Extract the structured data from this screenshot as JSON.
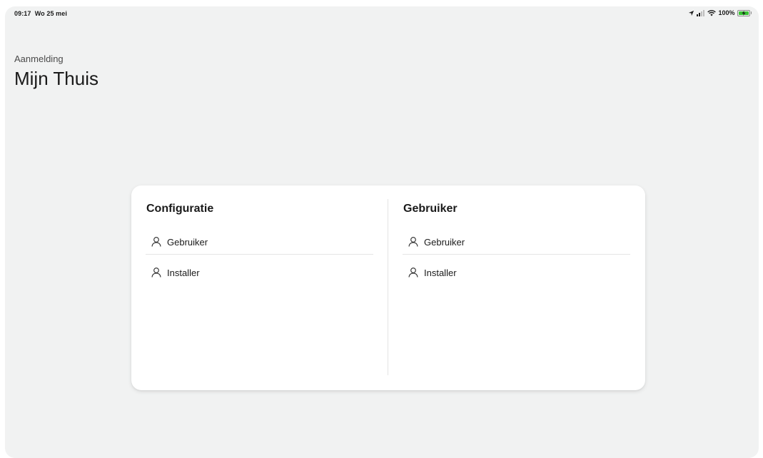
{
  "status_bar": {
    "time": "09:17",
    "date": "Wo 25 mei",
    "battery": "100%",
    "battery_color": "#39c234",
    "icons": [
      "location-arrow-icon",
      "signal-icon",
      "wifi-icon",
      "battery-charging-icon"
    ]
  },
  "header": {
    "subtitle": "Aanmelding",
    "title": "Mijn Thuis"
  },
  "panels": [
    {
      "title": "Configuratie",
      "items": [
        {
          "label": "Gebruiker",
          "icon": "user-icon"
        },
        {
          "label": "Installer",
          "icon": "user-icon"
        }
      ]
    },
    {
      "title": "Gebruiker",
      "items": [
        {
          "label": "Gebruiker",
          "icon": "user-icon"
        },
        {
          "label": "Installer",
          "icon": "user-icon"
        }
      ]
    }
  ]
}
